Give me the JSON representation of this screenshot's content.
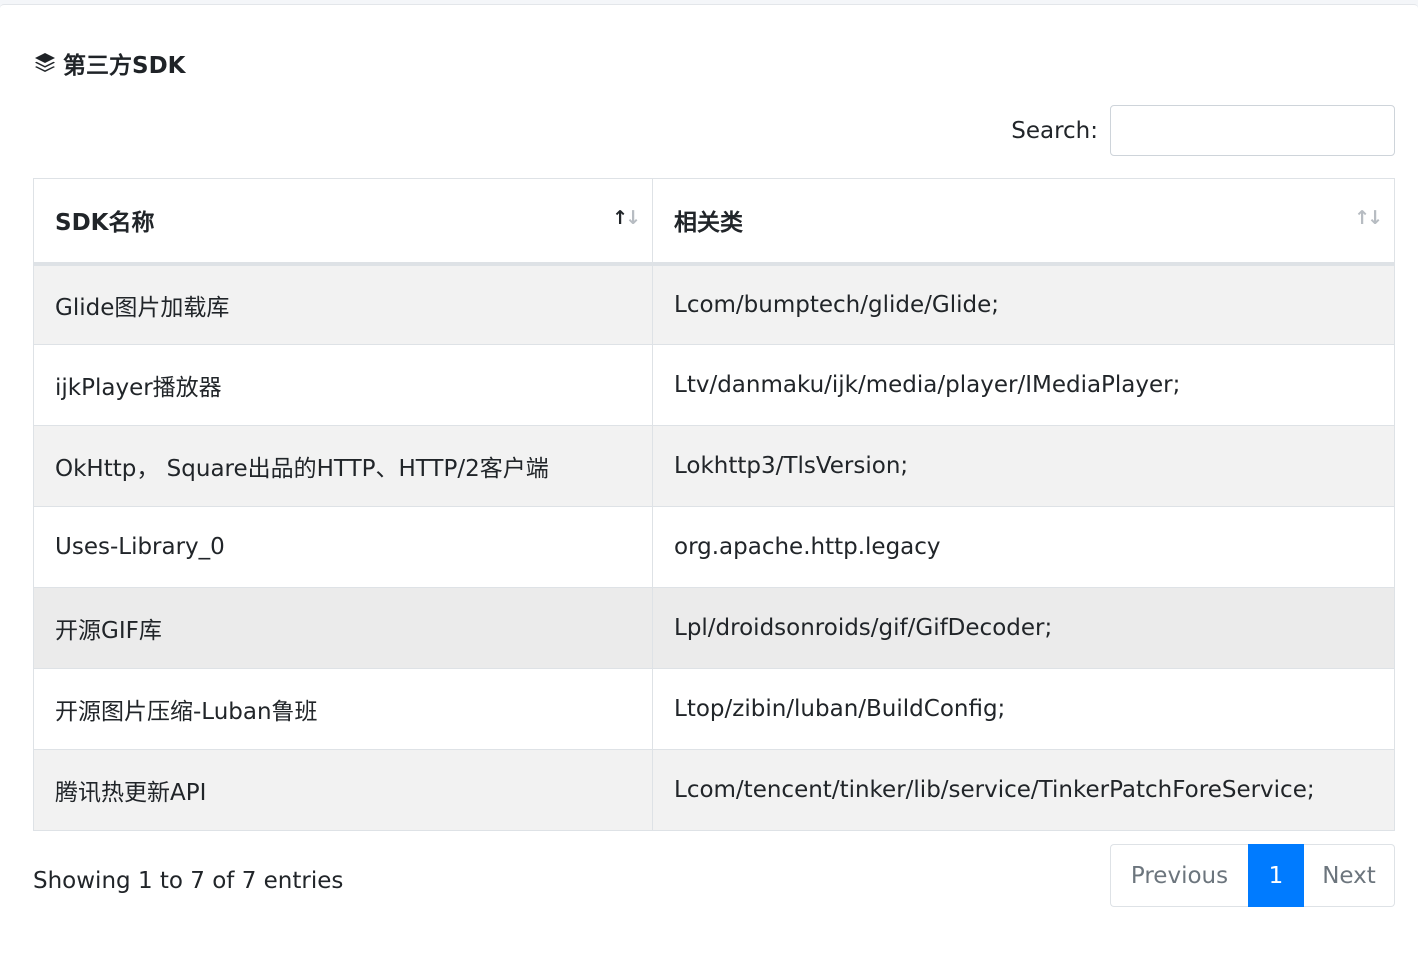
{
  "card": {
    "title": "第三方SDK",
    "icon": "layer-group-icon"
  },
  "search": {
    "label": "Search:",
    "value": "",
    "placeholder": ""
  },
  "table": {
    "columns": [
      {
        "label": "SDK名称",
        "sort": "ascending"
      },
      {
        "label": "相关类",
        "sort": "none"
      }
    ],
    "rows": [
      {
        "name": "Glide图片加载库",
        "cls": "Lcom/bumptech/glide/Glide;"
      },
      {
        "name": "ijkPlayer播放器",
        "cls": "Ltv/danmaku/ijk/media/player/IMediaPlayer;"
      },
      {
        "name": "OkHttp， Square出品的HTTP、HTTP/2客户端",
        "cls": "Lokhttp3/TlsVersion;"
      },
      {
        "name": "Uses-Library_0",
        "cls": "org.apache.http.legacy"
      },
      {
        "name": "开源GIF库",
        "cls": "Lpl/droidsonroids/gif/GifDecoder;"
      },
      {
        "name": "开源图片压缩-Luban鲁班",
        "cls": "Ltop/zibin/luban/BuildConfig;"
      },
      {
        "name": "腾讯热更新API",
        "cls": "Lcom/tencent/tinker/lib/service/TinkerPatchForeService;"
      }
    ]
  },
  "footer": {
    "info": "Showing 1 to 7 of 7 entries",
    "previous": "Previous",
    "page": "1",
    "next": "Next"
  },
  "colors": {
    "accent": "#007bff",
    "stripe": "#f2f2f2",
    "border": "#dee2e6"
  }
}
